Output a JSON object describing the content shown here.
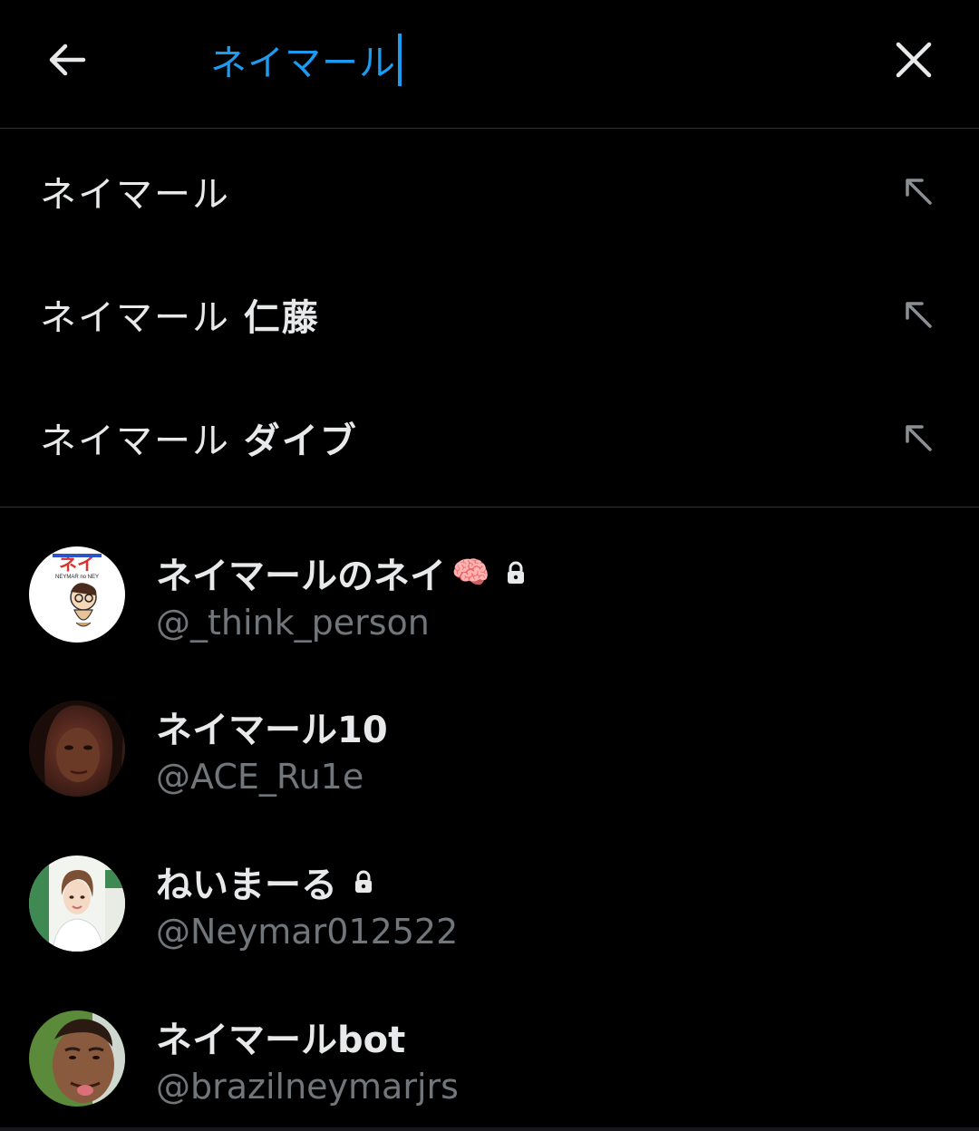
{
  "header": {
    "back_icon": "arrow-left-icon",
    "query": "ネイマール",
    "clear_icon": "close-icon"
  },
  "suggestions": [
    {
      "base": "ネイマール",
      "extra": "",
      "icon": "arrow-up-left-icon"
    },
    {
      "base": "ネイマール",
      "extra": "仁藤",
      "icon": "arrow-up-left-icon"
    },
    {
      "base": "ネイマール",
      "extra": "ダイブ",
      "icon": "arrow-up-left-icon"
    }
  ],
  "users": [
    {
      "name": "ネイマールのネイ",
      "emoji": "🧠",
      "locked": true,
      "handle": "@_think_person",
      "avatar_text": "ネイ",
      "avatar_subtext": "NEYMAR no NEY"
    },
    {
      "name": "ネイマール10",
      "emoji": "",
      "locked": false,
      "handle": "@ACE_Ru1e"
    },
    {
      "name": "ねいまーる",
      "emoji": "",
      "locked": true,
      "handle": "@Neymar012522"
    },
    {
      "name": "ネイマールbot",
      "emoji": "",
      "locked": false,
      "handle": "@brazilneymarjrs"
    }
  ],
  "colors": {
    "background": "#000000",
    "accent": "#1d9bf0",
    "text_primary": "#e7e9ea",
    "text_secondary": "#71767b",
    "divider": "#2f3336"
  }
}
